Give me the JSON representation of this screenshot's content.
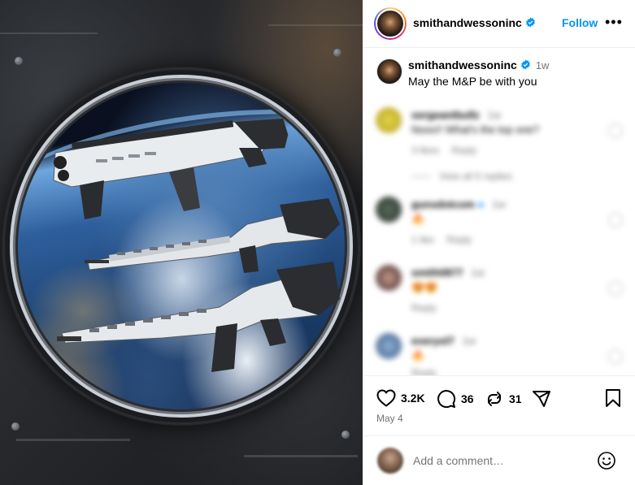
{
  "post": {
    "author": "smithandwessoninc",
    "follow_label": "Follow",
    "more_label": "•••",
    "caption": {
      "username": "smithandwessoninc",
      "time": "1w",
      "text": "May the M&P be with you"
    }
  },
  "comments": [
    {
      "username": "sergeantbullz",
      "time": "1w",
      "text": "Nooo!! What's the top one?",
      "likes": "3 likes",
      "reply": "Reply",
      "view_replies": "View all 5 replies"
    },
    {
      "username": "gunsdotcom",
      "time": "1w",
      "text": "🔥",
      "likes": "1 like",
      "reply": "Reply"
    },
    {
      "username": "smith0877",
      "time": "1w",
      "text": "😍😍",
      "reply": "Reply"
    },
    {
      "username": "everyol7",
      "time": "1w",
      "text": "🔥",
      "reply": "Reply"
    }
  ],
  "actions": {
    "likes": "3.2K",
    "comments": "36",
    "reposts": "31",
    "date": "May 4"
  },
  "comment_box": {
    "placeholder": "Add a comment…"
  },
  "colors": {
    "accent": "#0095f6",
    "verified": "#0095f6",
    "muted": "#737373"
  }
}
